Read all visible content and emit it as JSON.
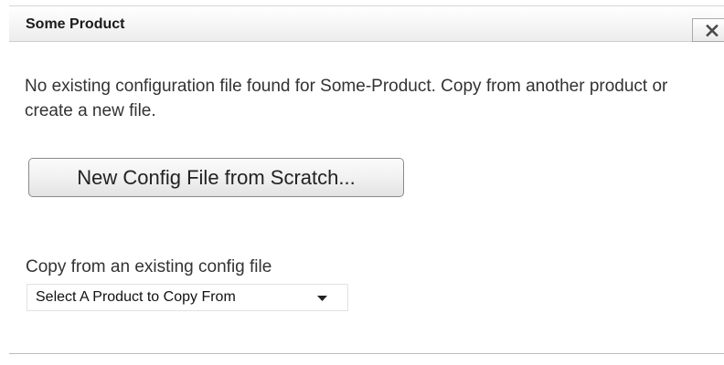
{
  "dialog": {
    "title": "Some Product",
    "close_icon": "close-icon",
    "message": "No existing configuration file found for Some-Product. Copy from another product or create a new file.",
    "new_button_label": "New Config File from Scratch...",
    "copy_label": "Copy from an existing config file",
    "select": {
      "selected": "Select A Product to Copy From",
      "arrow_icon": "chevron-down-icon"
    }
  }
}
